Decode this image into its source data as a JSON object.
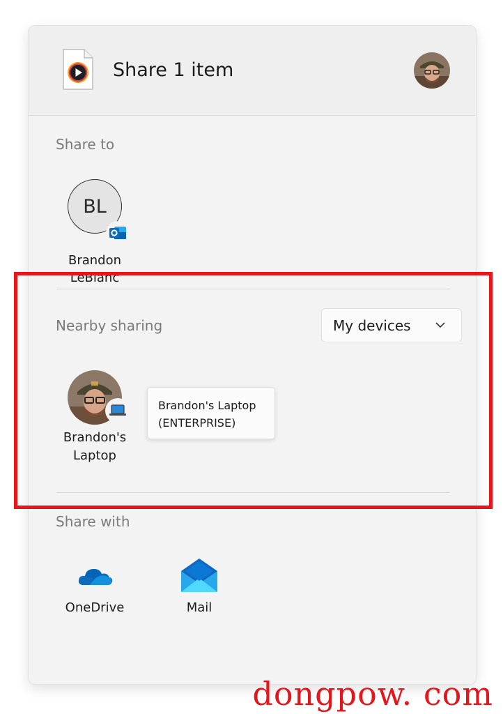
{
  "header": {
    "title": "Share 1 item",
    "file_icon": "media-file-icon",
    "avatar_icon": "user-avatar"
  },
  "share_to": {
    "label": "Share to",
    "contacts": [
      {
        "initials": "BL",
        "name_line1": "Brandon",
        "name_line2": "LeBlanc",
        "badge_icon": "outlook-icon"
      }
    ]
  },
  "nearby_sharing": {
    "label": "Nearby sharing",
    "dropdown_value": "My devices",
    "devices": [
      {
        "name_line1": "Brandon's",
        "name_line2": "Laptop",
        "badge_icon": "laptop-icon"
      }
    ],
    "tooltip_line1": "Brandon's Laptop",
    "tooltip_line2": "(ENTERPRISE)"
  },
  "share_with": {
    "label": "Share with",
    "apps": [
      {
        "label": "OneDrive",
        "icon": "onedrive-icon"
      },
      {
        "label": "Mail",
        "icon": "mail-icon"
      }
    ]
  },
  "watermark": "dongpow. com",
  "colors": {
    "highlight": "#e8151b",
    "dialog_bg": "#f3f3f3",
    "section_label": "#7a7a7a",
    "onedrive_blue": "#0f6cbd",
    "mail_blue": "#0a78d4"
  }
}
